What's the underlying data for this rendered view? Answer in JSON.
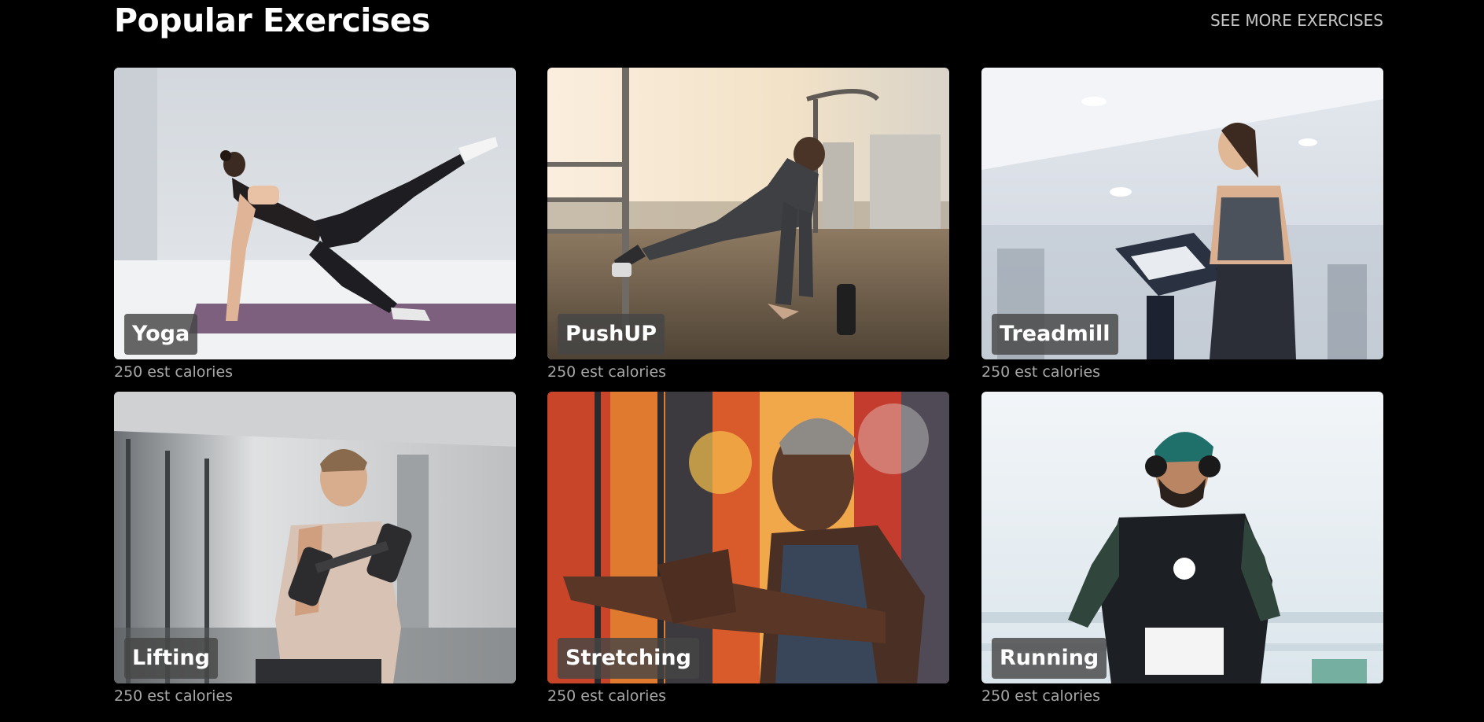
{
  "header": {
    "title": "Popular Exercises",
    "see_more_label": "SEE MORE EXERCISES"
  },
  "exercises": [
    {
      "name": "Yoga",
      "calories": "250 est calories"
    },
    {
      "name": "PushUP",
      "calories": "250 est calories"
    },
    {
      "name": "Treadmill",
      "calories": "250 est calories"
    },
    {
      "name": "Lifting",
      "calories": "250 est calories"
    },
    {
      "name": "Stretching",
      "calories": "250 est calories"
    },
    {
      "name": "Running",
      "calories": "250 est calories"
    }
  ]
}
